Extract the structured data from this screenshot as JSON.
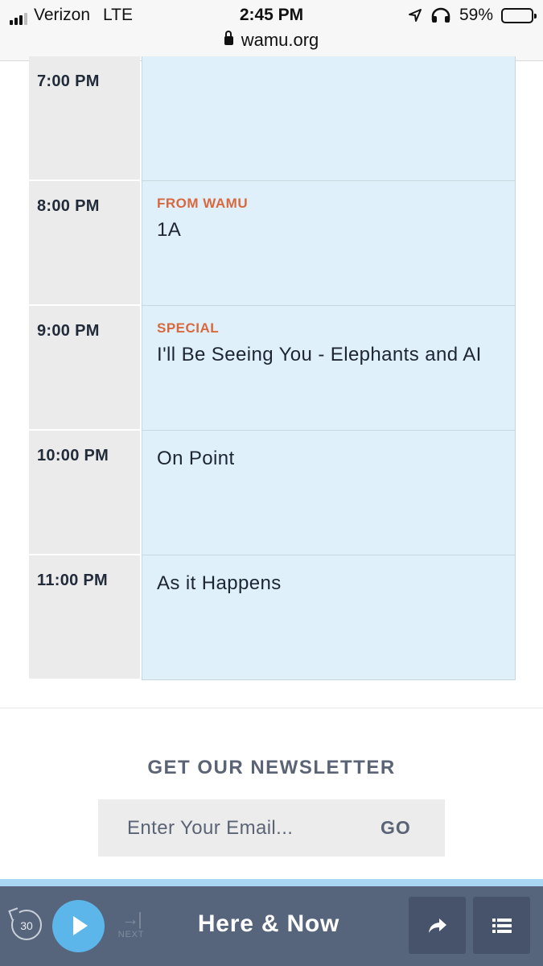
{
  "status_bar": {
    "carrier": "Verizon",
    "network": "LTE",
    "time": "2:45 PM",
    "url": "wamu.org",
    "battery": "59%",
    "battery_level": 0.59
  },
  "schedule": [
    {
      "time": "7:00 PM",
      "kicker": "",
      "title": ""
    },
    {
      "time": "8:00 PM",
      "kicker": "FROM WAMU",
      "title": "1A"
    },
    {
      "time": "9:00 PM",
      "kicker": "SPECIAL",
      "title": "I'll Be Seeing You - Elephants and AI"
    },
    {
      "time": "10:00 PM",
      "kicker": "",
      "title": "On Point"
    },
    {
      "time": "11:00 PM",
      "kicker": "",
      "title": "As it Happens"
    }
  ],
  "newsletter": {
    "heading": "GET OUR NEWSLETTER",
    "placeholder": "Enter Your Email...",
    "button": "GO"
  },
  "player": {
    "skip_seconds": "30",
    "next_label": "NEXT",
    "now_playing": "Here & Now"
  },
  "colors": {
    "accent_kicker": "#d9683e",
    "show_bg": "#dff0fa",
    "player_bg": "#56657c",
    "play_button": "#5cb6ea"
  },
  "icons": {
    "skip_back": "skip-back-30-icon",
    "play": "play-icon",
    "next": "next-track-icon",
    "share": "share-arrow-icon",
    "menu": "list-menu-icon",
    "lock": "lock-icon",
    "location": "location-arrow-icon",
    "headphones": "headphones-icon"
  }
}
